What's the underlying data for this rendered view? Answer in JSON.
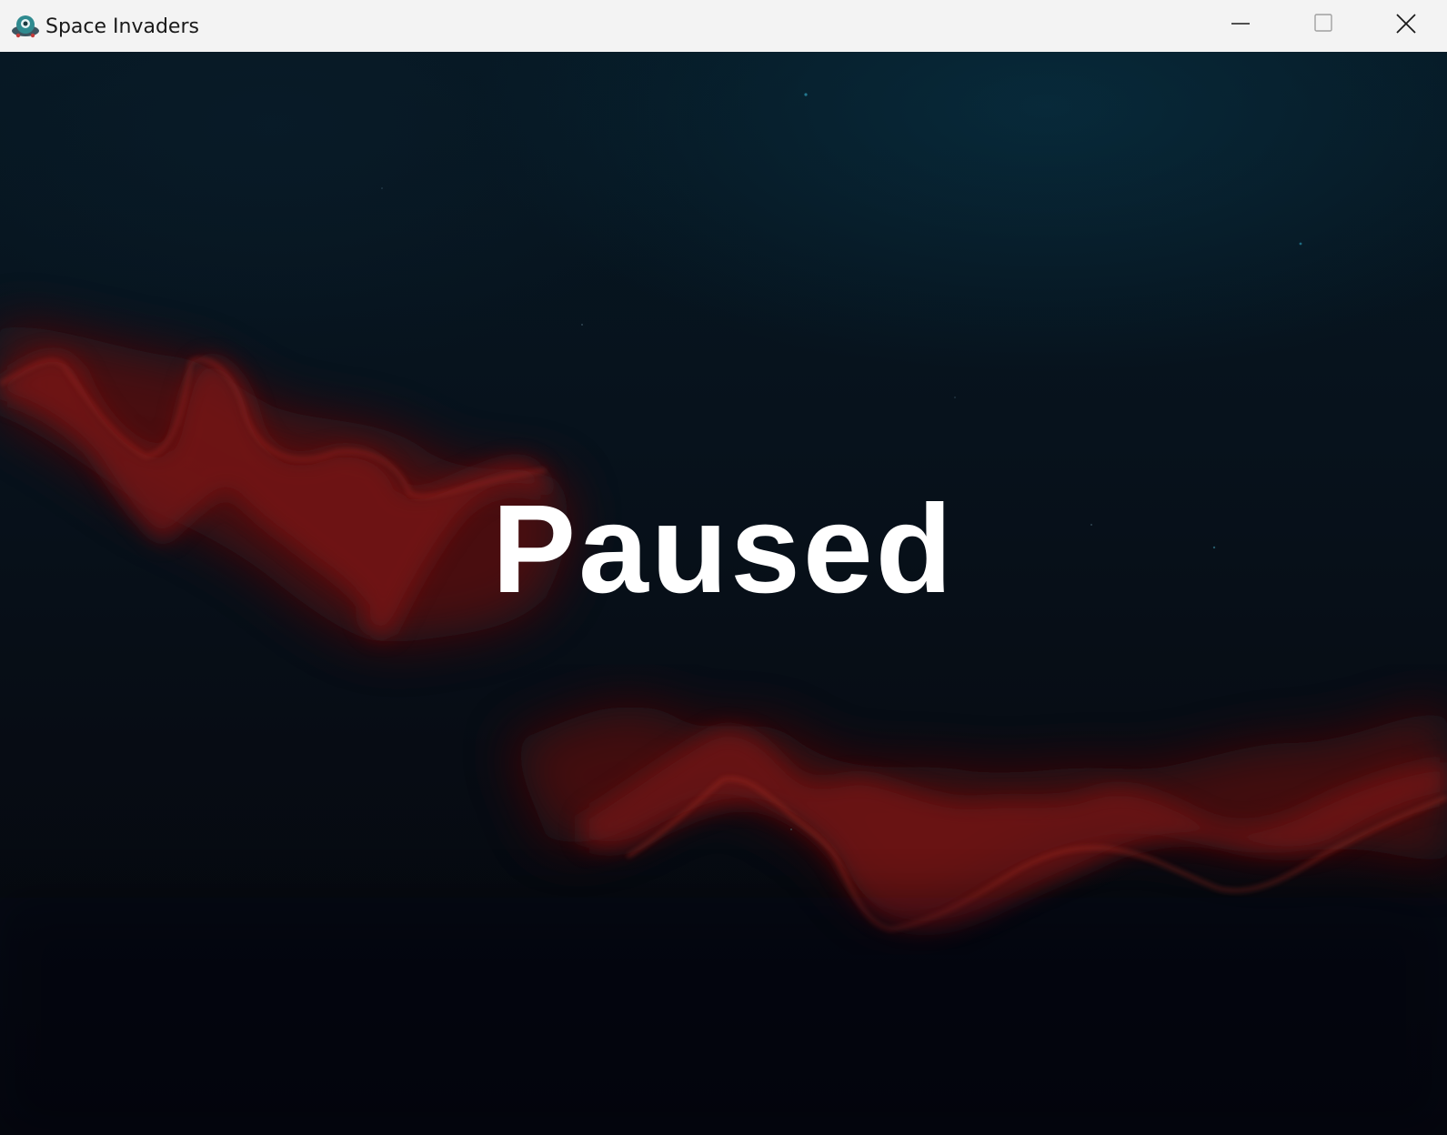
{
  "window": {
    "title": "Space Invaders",
    "icon": "alien-ufo-icon",
    "controls": {
      "minimize": "minimize-icon",
      "maximize": "maximize-icon",
      "close": "close-icon"
    }
  },
  "game": {
    "status_text": "Paused",
    "background": "dark-space-nebula-red",
    "colors": {
      "text": "#ffffff",
      "nebula_red": "#8a1a16",
      "space_dark": "#07121c"
    }
  }
}
